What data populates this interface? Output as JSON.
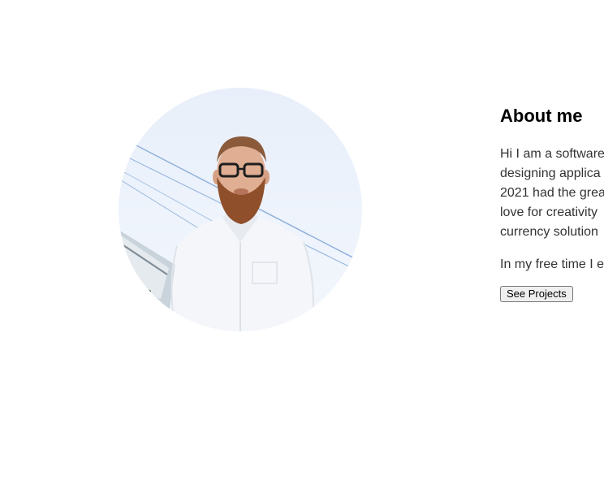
{
  "about": {
    "heading": "About me",
    "body_lines": [
      "Hi I am a software",
      "designing applica",
      "2021 had the grea",
      "love for creativity",
      "currency solution"
    ],
    "free_time": "In my free time I e",
    "projects_button_label": "See Projects"
  }
}
